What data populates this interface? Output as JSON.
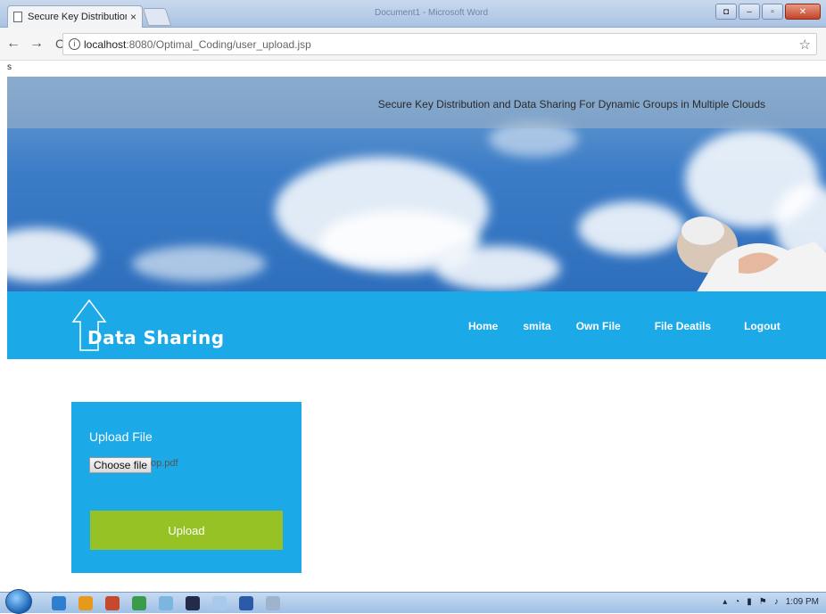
{
  "browser": {
    "tab_title": "Secure Key Distribution a",
    "tab_close": "×",
    "window_title": "Document1 - Microsoft Word",
    "url_host": "localhost",
    "url_path": ":8080/Optimal_Coding/user_upload.jsp",
    "back": "←",
    "forward": "→",
    "reload": "C",
    "info": "i",
    "star": "☆"
  },
  "stray_text": "s",
  "hero": {
    "tagline": "Secure Key Distribution and Data Sharing For Dynamic Groups in Multiple Clouds"
  },
  "navbar": {
    "logo_text": "Data Sharing",
    "links": [
      "Home",
      "smita",
      "Own File",
      "File Deatils",
      "Logout"
    ]
  },
  "upload": {
    "title": "Upload File",
    "choose_label": "Choose file",
    "file_name": "op.pdf",
    "button_label": "Upload"
  },
  "taskbar": {
    "time": "1:09 PM"
  },
  "colors": {
    "navbar": "#1ca9e8",
    "upload_button": "#97c225"
  }
}
